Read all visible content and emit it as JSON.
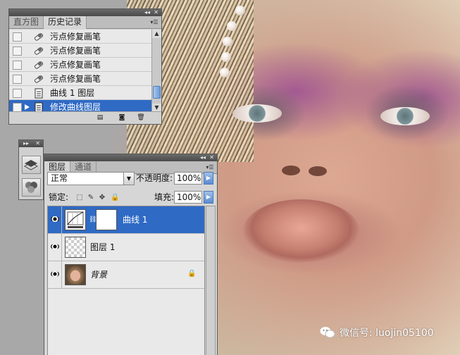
{
  "history_panel": {
    "tabs": [
      "直方图",
      "历史记录"
    ],
    "active_tab": 1,
    "items": [
      {
        "label": "污点修复画笔",
        "icon": "brush-icon",
        "selected": false
      },
      {
        "label": "污点修复画笔",
        "icon": "brush-icon",
        "selected": false
      },
      {
        "label": "污点修复画笔",
        "icon": "brush-icon",
        "selected": false
      },
      {
        "label": "污点修复画笔",
        "icon": "brush-icon",
        "selected": false
      },
      {
        "label": "曲线 1 图层",
        "icon": "document-icon",
        "selected": false
      },
      {
        "label": "修改曲线图层",
        "icon": "document-icon",
        "selected": true
      }
    ],
    "footer_icons": [
      "new-document-from-state-icon",
      "camera-snapshot-icon",
      "trash-icon"
    ]
  },
  "layers_panel": {
    "tabs": [
      "图层",
      "通道"
    ],
    "active_tab": 0,
    "blend_mode": "正常",
    "opacity_label": "不透明度:",
    "opacity_value": "100%",
    "lock_label": "锁定:",
    "fill_label": "填充:",
    "fill_value": "100%",
    "layers": [
      {
        "name": "曲线 1",
        "type": "adjustment-curves",
        "visible": true,
        "selected": true
      },
      {
        "name": "图层 1",
        "type": "transparent",
        "visible": true,
        "selected": false
      },
      {
        "name": "背景",
        "type": "background",
        "visible": true,
        "selected": false,
        "locked": true
      }
    ]
  },
  "watermark": {
    "text": "微信号: luojin05100"
  },
  "colors": {
    "selection": "#2f6ac5",
    "panel_bg": "#d6d6d6",
    "titlebar": "#4a4a4a"
  }
}
